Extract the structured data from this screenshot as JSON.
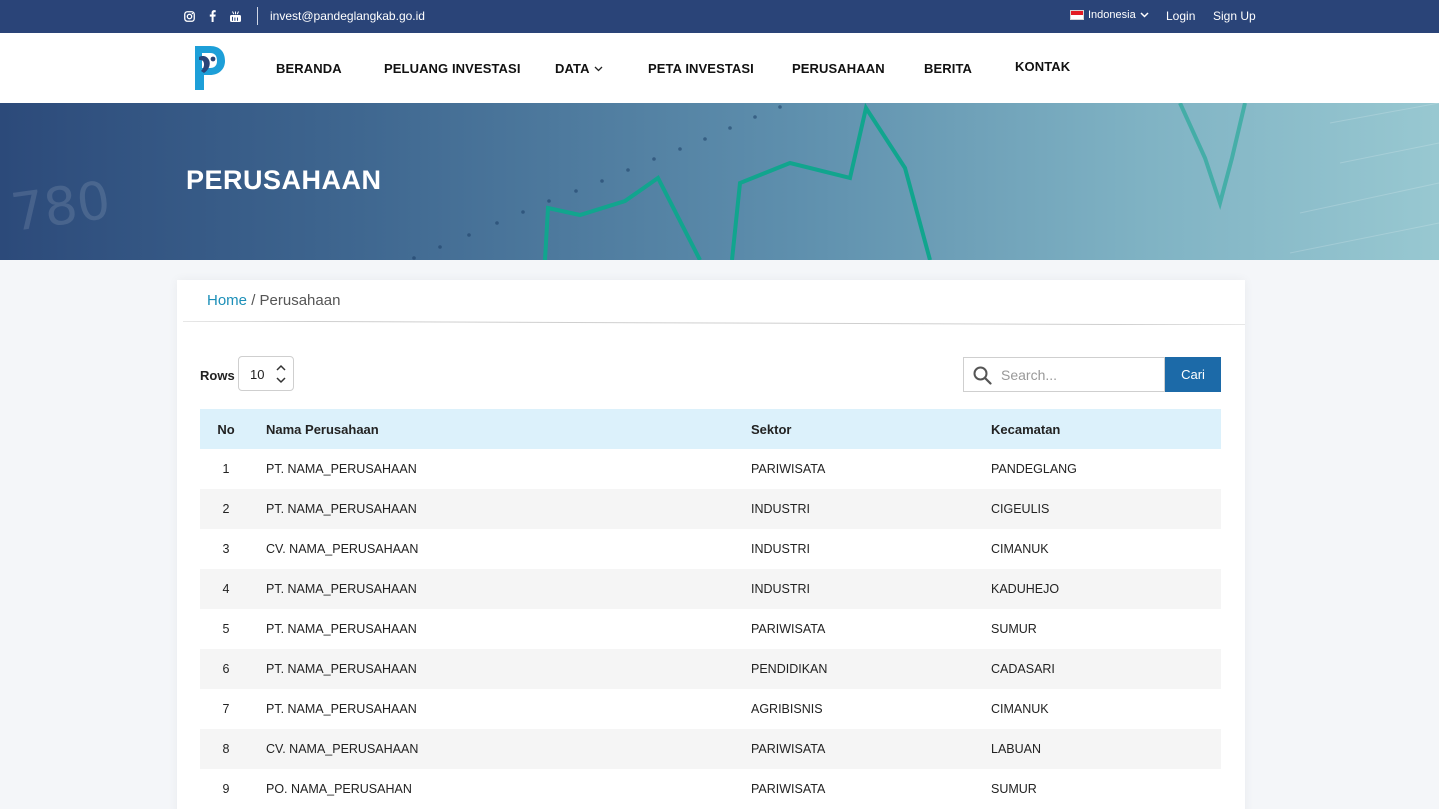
{
  "topbar": {
    "social_icons": [
      "instagram-icon",
      "facebook-icon",
      "youtube-icon"
    ],
    "email": "invest@pandeglangkab.go.id",
    "language": "Indonesia",
    "login": "Login",
    "signup": "Sign Up"
  },
  "nav": {
    "items": [
      "BERANDA",
      "PELUANG INVESTASI",
      "DATA",
      "PETA INVESTASI",
      "PERUSAHAAN",
      "BERITA",
      "KONTAK"
    ]
  },
  "hero": {
    "title": "PERUSAHAAN",
    "background_text": "780"
  },
  "breadcrumb": {
    "home": "Home",
    "separator": "/",
    "current": "Perusahaan"
  },
  "controls": {
    "rows_label": "Rows",
    "rows_value": "10",
    "search_placeholder": "Search...",
    "search_button": "Cari"
  },
  "table": {
    "headers": [
      "No",
      "Nama Perusahaan",
      "Sektor",
      "Kecamatan"
    ],
    "rows": [
      [
        "1",
        "PT. NAMA_PERUSAHAAN",
        "PARIWISATA",
        "PANDEGLANG"
      ],
      [
        "2",
        "PT. NAMA_PERUSAHAAN",
        "INDUSTRI",
        "CIGEULIS"
      ],
      [
        "3",
        "CV. NAMA_PERUSAHAAN",
        "INDUSTRI",
        "CIMANUK"
      ],
      [
        "4",
        "PT. NAMA_PERUSAHAAN",
        "INDUSTRI",
        "KADUHEJO"
      ],
      [
        "5",
        "PT. NAMA_PERUSAHAAN",
        "PARIWISATA",
        "SUMUR"
      ],
      [
        "6",
        "PT. NAMA_PERUSAHAAN",
        "PENDIDIKAN",
        "CADASARI"
      ],
      [
        "7",
        "PT. NAMA_PERUSAHAAN",
        "AGRIBISNIS",
        "CIMANUK"
      ],
      [
        "8",
        "CV. NAMA_PERUSAHAAN",
        "PARIWISATA",
        "LABUAN"
      ],
      [
        "9",
        "PO. NAMA_PERUSAHAN",
        "PARIWISATA",
        "SUMUR"
      ]
    ]
  },
  "colors": {
    "topbar": "#2a4478",
    "accent_link": "#1c8fb8",
    "button": "#1c6aa8",
    "table_header": "#dcf1fb"
  }
}
